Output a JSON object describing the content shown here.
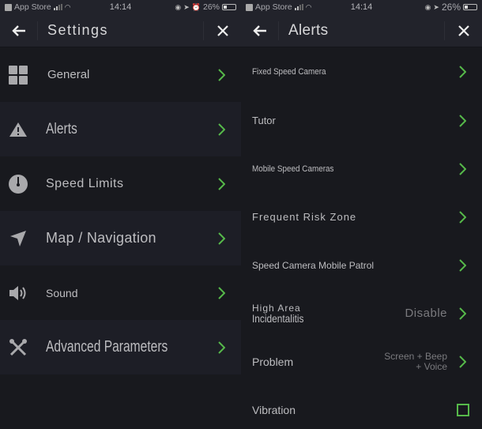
{
  "status_bar": {
    "carrier": "App Store",
    "time": "14:14",
    "battery": "26%"
  },
  "left_screen": {
    "title": "Settings",
    "back_icon": "arrow-left-icon",
    "close_icon": "close-icon",
    "items": [
      {
        "label": "General",
        "icon": "grid-icon"
      },
      {
        "label": "Alerts",
        "icon": "warning-icon"
      },
      {
        "label": "Speed Limits",
        "icon": "speedometer-icon"
      },
      {
        "label": "Map / Navigation",
        "icon": "navigation-arrow-icon"
      },
      {
        "label": "Sound",
        "icon": "speaker-icon"
      },
      {
        "label": "Advanced Parameters",
        "icon": "tools-icon"
      }
    ]
  },
  "right_screen": {
    "title": "Alerts",
    "back_icon": "arrow-left-icon",
    "close_icon": "close-icon",
    "items": [
      {
        "label": "Fixed Speed Camera",
        "value": ""
      },
      {
        "label": "Tutor",
        "value": ""
      },
      {
        "label": "Mobile Speed Cameras",
        "value": ""
      },
      {
        "label": "Frequent Risk Zone",
        "value": ""
      },
      {
        "label": "Speed Camera Mobile Patrol",
        "value": ""
      },
      {
        "label_line1": "High Area",
        "label_line2": "Incidentalitis",
        "value": "Disable"
      },
      {
        "label": "Problem",
        "value_line1": "Screen + Beep",
        "value_line2": "+ Voice"
      },
      {
        "label": "Vibration",
        "checked": false
      }
    ]
  },
  "colors": {
    "accent": "#56b94a",
    "background": "#18191e",
    "header": "#22232b",
    "row_alt": "#1d1e26"
  }
}
